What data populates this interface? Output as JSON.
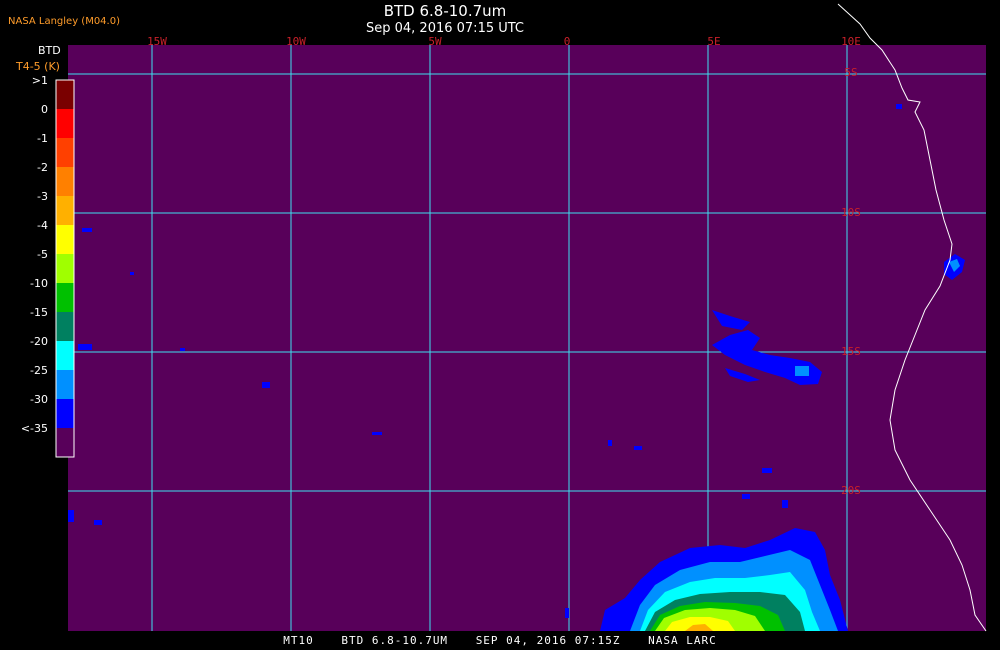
{
  "header": {
    "producer": "NASA Langley (M04.0)",
    "title": "BTD 6.8-10.7um",
    "subtitle": "Sep 04, 2016 07:15 UTC"
  },
  "legend": {
    "title": "BTD",
    "units": "T4-5 (K)",
    "labels": [
      ">1",
      "0",
      "-1",
      "-2",
      "-3",
      "-4",
      "-5",
      "-10",
      "-15",
      "-20",
      "-25",
      "-30",
      "<-35"
    ],
    "colors": [
      "#7a0000",
      "#ff0000",
      "#ff4000",
      "#ff8000",
      "#ffb000",
      "#ffff00",
      "#a0ff00",
      "#00c000",
      "#008060",
      "#00ffff",
      "#0090ff",
      "#0000ff",
      "#58005a"
    ]
  },
  "map": {
    "background_color": "#58005a",
    "grid_color": "#3ee0f0",
    "coast_color": "#ffffff",
    "longitude_labels": [
      "15W",
      "10W",
      "5W",
      "0",
      "5E",
      "10E"
    ],
    "latitude_labels": [
      "5S",
      "10S",
      "15S",
      "20S"
    ]
  },
  "footer": {
    "satellite": "MT10",
    "product": "BTD 6.8-10.7UM",
    "datetime": "SEP 04, 2016 07:15Z",
    "agency": "NASA LARC"
  }
}
